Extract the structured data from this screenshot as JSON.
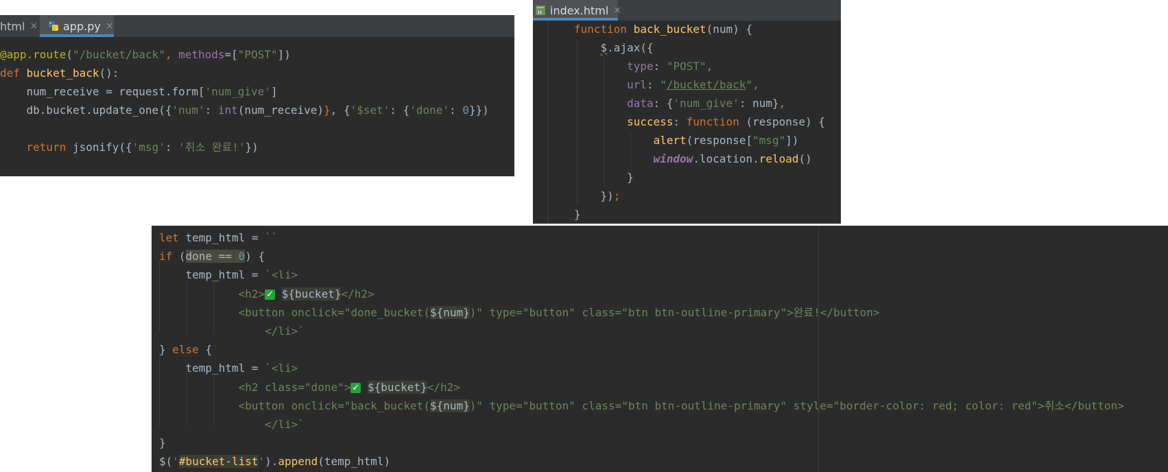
{
  "left_panel": {
    "tabs": [
      {
        "label": "html",
        "close": "×"
      },
      {
        "label": "app.py",
        "close": "×"
      }
    ],
    "code": [
      {
        "segs": [
          [
            "dc",
            "@app.route"
          ],
          [
            "",
            "("
          ],
          [
            "st",
            "\"/bucket/back\""
          ],
          [
            "kw",
            ", "
          ],
          [
            "pp",
            "methods"
          ],
          [
            "",
            "=["
          ],
          [
            "st",
            "\"POST\""
          ],
          [
            "",
            "])"
          ]
        ]
      },
      {
        "segs": [
          [
            "kw",
            "def "
          ],
          [
            "fn",
            "bucket_back"
          ],
          [
            "",
            "():"
          ]
        ]
      },
      {
        "segs": [
          [
            "",
            "    num_receive = request.form["
          ],
          [
            "st",
            "'num_give'"
          ],
          [
            "",
            "]"
          ]
        ]
      },
      {
        "segs": [
          [
            "",
            "    db.bucket.update_one({"
          ],
          [
            "st",
            "'num'"
          ],
          [
            "",
            ": "
          ],
          [
            "pp",
            "int"
          ],
          [
            "",
            "(num_receive)"
          ],
          [
            "kw",
            "}"
          ],
          [
            "",
            ", {"
          ],
          [
            "st",
            "'$set'"
          ],
          [
            "",
            ": {"
          ],
          [
            "st",
            "'done'"
          ],
          [
            "",
            ": "
          ],
          [
            "nm",
            "0"
          ],
          [
            "",
            "}})"
          ]
        ]
      },
      {
        "segs": [
          [
            "",
            ""
          ]
        ]
      },
      {
        "segs": [
          [
            "kw",
            "    return "
          ],
          [
            "",
            "jsonify({"
          ],
          [
            "st",
            "'msg'"
          ],
          [
            "",
            ": "
          ],
          [
            "st",
            "'취소 완료!'"
          ],
          [
            "",
            "})"
          ]
        ]
      }
    ]
  },
  "right_panel": {
    "tabs": [
      {
        "label": "index.html",
        "close": "×"
      }
    ],
    "code": [
      {
        "segs": [
          [
            "kw",
            "function "
          ],
          [
            "fn",
            "back_bucket"
          ],
          [
            "",
            "(num) {"
          ]
        ]
      },
      {
        "segs": [
          [
            "",
            "    "
          ],
          [
            "wavy",
            "$"
          ],
          [
            "",
            ".ajax({"
          ]
        ]
      },
      {
        "segs": [
          [
            "",
            "        "
          ],
          [
            "pp",
            "type"
          ],
          [
            "",
            ": "
          ],
          [
            "st",
            "\"POST\""
          ],
          [
            "kw",
            ","
          ]
        ]
      },
      {
        "segs": [
          [
            "",
            "        "
          ],
          [
            "pp",
            "url"
          ],
          [
            "",
            ": "
          ],
          [
            "st",
            "\""
          ],
          [
            "ul st",
            "/bucket/back"
          ],
          [
            "st",
            "\""
          ],
          [
            "kw",
            ","
          ]
        ]
      },
      {
        "segs": [
          [
            "",
            "        "
          ],
          [
            "pp",
            "data"
          ],
          [
            "",
            ": {"
          ],
          [
            "st",
            "'num_give'"
          ],
          [
            "",
            ": num}"
          ],
          [
            "kw",
            ","
          ]
        ]
      },
      {
        "segs": [
          [
            "",
            "        "
          ],
          [
            "fn",
            "success"
          ],
          [
            "",
            ": "
          ],
          [
            "kw",
            "function "
          ],
          [
            "",
            "(response) {"
          ]
        ]
      },
      {
        "segs": [
          [
            "",
            "            "
          ],
          [
            "fn",
            "alert"
          ],
          [
            "",
            "(response["
          ],
          [
            "st",
            "\"msg\""
          ],
          [
            "",
            "])"
          ]
        ]
      },
      {
        "segs": [
          [
            "",
            "            "
          ],
          [
            "win",
            "window"
          ],
          [
            "",
            ".location."
          ],
          [
            "fn",
            "reload"
          ],
          [
            "",
            "()"
          ]
        ]
      },
      {
        "segs": [
          [
            "",
            "        }"
          ]
        ]
      },
      {
        "segs": [
          [
            "",
            "    })"
          ],
          [
            "kw",
            ";"
          ]
        ]
      },
      {
        "segs": [
          [
            "",
            "}"
          ]
        ]
      }
    ]
  },
  "bottom_panel": {
    "code": [
      {
        "segs": [
          [
            "kw",
            "let "
          ],
          [
            "",
            "temp_html = "
          ],
          [
            "st",
            "``"
          ]
        ]
      },
      {
        "segs": [
          [
            "kw",
            "if "
          ],
          [
            "",
            "("
          ],
          [
            "hl2",
            "done == "
          ],
          [
            "hl2 nm",
            "0"
          ],
          [
            "",
            ") {"
          ]
        ]
      },
      {
        "segs": [
          [
            "",
            "    temp_html = "
          ],
          [
            "st",
            "`<li>"
          ]
        ]
      },
      {
        "segs": [
          [
            "st",
            "            <h2>"
          ],
          [
            "check",
            "✓"
          ],
          [
            "st",
            " "
          ],
          [
            "hl",
            "${bucket}"
          ],
          [
            "st",
            "</h2>"
          ]
        ]
      },
      {
        "segs": [
          [
            "st",
            "            <button onclick=\"done_bucket("
          ],
          [
            "hl",
            "${num}"
          ],
          [
            "st",
            ")\" type=\"button\" class=\"btn btn-outline-primary\">완료!</button>"
          ]
        ]
      },
      {
        "segs": [
          [
            "st",
            "                </li>`"
          ]
        ]
      },
      {
        "segs": [
          [
            "",
            "} "
          ],
          [
            "kw",
            "else "
          ],
          [
            "",
            "{"
          ]
        ]
      },
      {
        "segs": [
          [
            "",
            "    temp_html = "
          ],
          [
            "st",
            "`<li>"
          ]
        ]
      },
      {
        "segs": [
          [
            "st",
            "            <h2 class=\"done\">"
          ],
          [
            "check",
            "✓"
          ],
          [
            "st",
            " "
          ],
          [
            "hl",
            "${bucket}"
          ],
          [
            "st",
            "</h2>"
          ]
        ]
      },
      {
        "segs": [
          [
            "st",
            "            <button onclick=\"back_bucket("
          ],
          [
            "hl",
            "${num}"
          ],
          [
            "st",
            ")\" type=\"button\" class=\"btn btn-outline-primary\" style=\"border-color: red; color: red\">취소</button>"
          ]
        ]
      },
      {
        "segs": [
          [
            "st",
            "                </li>`"
          ]
        ]
      },
      {
        "segs": [
          [
            "",
            "}"
          ]
        ]
      },
      {
        "segs": [
          [
            "",
            "$("
          ],
          [
            "st",
            "'"
          ],
          [
            "hl fn",
            "#bucket-list"
          ],
          [
            "st",
            "'"
          ],
          [
            "",
            ")."
          ],
          [
            "fn",
            "append"
          ],
          [
            "",
            "(temp_html)"
          ]
        ]
      }
    ]
  }
}
